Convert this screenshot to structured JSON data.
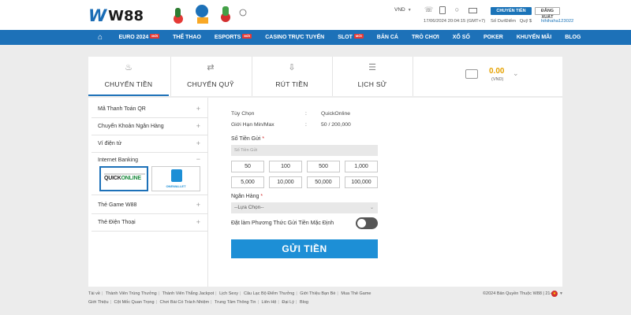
{
  "brand": {
    "logo_mark": "W",
    "logo_text": "W88"
  },
  "header": {
    "currency": "VND",
    "transfer_button": "CHUYỂN TIỀN",
    "logout_button": "ĐĂNG XUẤT",
    "datetime": "17/06/2024 20:04:15 (GMT+7)",
    "balance_label": "Số Dư/Điểm",
    "fund_label": "Quỹ $",
    "username": "hihihaha123022",
    "icons": [
      "phone-icon",
      "mobile-icon",
      "chat-icon",
      "mail-icon"
    ]
  },
  "nav": {
    "items": [
      {
        "label": "EURO 2024",
        "badge": "MỚI"
      },
      {
        "label": "THỂ THAO",
        "badge": ""
      },
      {
        "label": "ESPORTS",
        "badge": "MỚI"
      },
      {
        "label": "CASINO TRỰC TUYẾN",
        "badge": ""
      },
      {
        "label": "SLOT",
        "badge": "MỚI"
      },
      {
        "label": "BẮN CÁ",
        "badge": ""
      },
      {
        "label": "TRÒ CHƠI",
        "badge": ""
      },
      {
        "label": "XỔ SỐ",
        "badge": ""
      },
      {
        "label": "POKER",
        "badge": ""
      },
      {
        "label": "KHUYẾN MÃI",
        "badge": ""
      },
      {
        "label": "BLOG",
        "badge": ""
      }
    ]
  },
  "tabs": [
    {
      "label": "CHUYỂN TIỀN",
      "icon": "piggy-bank-icon",
      "active": true
    },
    {
      "label": "CHUYỂN QUỸ",
      "icon": "transfer-icon",
      "active": false
    },
    {
      "label": "RÚT TIỀN",
      "icon": "withdraw-icon",
      "active": false
    },
    {
      "label": "LỊCH SỬ",
      "icon": "history-icon",
      "active": false
    }
  ],
  "wallet": {
    "amount": "0.00",
    "currency": "(VND)"
  },
  "sidebar": {
    "items": [
      {
        "label": "Mã Thanh Toán QR"
      },
      {
        "label": "Chuyển Khoản Ngân Hàng"
      },
      {
        "label": "Ví điện tử"
      },
      {
        "label": "Internet Banking"
      },
      {
        "label": "Thẻ Game W88"
      },
      {
        "label": "Thẻ Điện Thoại"
      }
    ],
    "bank_options": [
      {
        "name": "QUICKONLINE",
        "selected": true
      },
      {
        "name": "ONEWALLET",
        "selected": false
      }
    ]
  },
  "form": {
    "option_label": "Tùy Chọn",
    "option_value": "QuickOnline",
    "limit_label": "Giới Hạn Min/Max",
    "limit_value": "50 / 200,000",
    "colon": ":",
    "amount_label": "Số Tiền Gửi",
    "required_mark": "*",
    "amount_placeholder": "Số Tiền Gửi",
    "quick_amounts": [
      "50",
      "100",
      "500",
      "1,000",
      "5,000",
      "10,000",
      "50,000",
      "100,000"
    ],
    "bank_label": "Ngân Hàng",
    "bank_select_value": "--Lựa Chọn--",
    "default_method_label": "Đặt làm Phương Thức Gửi Tiền Mặc Định",
    "default_method_on": false,
    "submit_label": "GỬI TIỀN"
  },
  "footer": {
    "row1": [
      "Tài về",
      "Thành Viên Trúng Thưởng",
      "Thành Viên Thắng Jackpot",
      "Lịch Sexy",
      "Câu Lạc Bộ Điểm Thưởng",
      "Giới Thiệu Bạn Bè",
      "Mua Thẻ Game"
    ],
    "row2": [
      "Giới Thiệu",
      "Cột Mốc Quan Trọng",
      "Chơi Bài Có Trách Nhiệm",
      "Trung Tâm Thông Tin",
      "Liên Hệ",
      "Đại Lý",
      "Blog"
    ],
    "copyright": "©2024 Bản Quyền Thuộc W88 | 21+",
    "separator": "|"
  },
  "colors": {
    "primary": "#1d71b8",
    "submit": "#1d8fd6",
    "wallet_amount": "#e6a200",
    "badge": "#e53935"
  }
}
